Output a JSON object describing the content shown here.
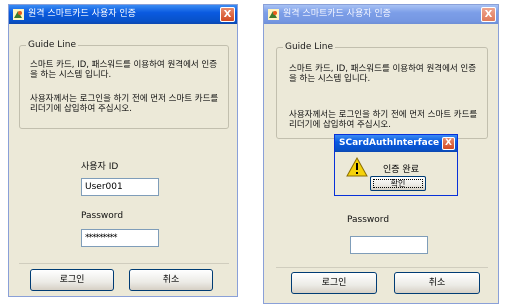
{
  "window": {
    "title": "원격 스마트카드 사용자 인증",
    "close_glyph": "X"
  },
  "guide": {
    "legend": "Guide Line",
    "line1": "스마트 카드, ID, 패스워드를 이용하여 원격에서 인증",
    "line2": "을 하는 시스템 입니다.",
    "line3": "사용자께서는 로그인을 하기 전에 먼저 스마트 카드를",
    "line4": "리더기에 삽입하여 주십시오."
  },
  "form_left": {
    "user_id_label": "사용자 ID",
    "user_id_value": "User001",
    "password_label": "Password",
    "password_value": "*********",
    "login_button": "로그인",
    "cancel_button": "취소"
  },
  "form_right": {
    "password_label": "Password",
    "password_value": "",
    "login_button": "로그인",
    "cancel_button": "취소"
  },
  "dialog": {
    "title": "SCardAuthInterface",
    "message": "인증 완료",
    "ok_button": "확인",
    "icon": "warning-icon"
  },
  "colors": {
    "titlebar": "#0a5ae0",
    "window_bg": "#ece9d8",
    "close": "#d34a22"
  }
}
